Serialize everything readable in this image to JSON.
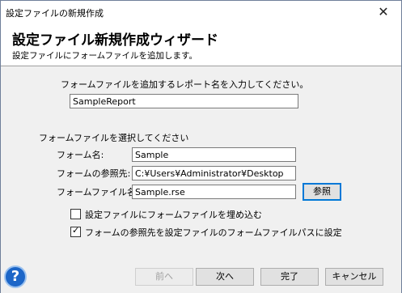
{
  "window": {
    "title": "設定ファイルの新規作成",
    "close_glyph": "✕"
  },
  "header": {
    "title": "設定ファイル新規作成ウィザード",
    "subtitle": "設定ファイルにフォームファイルを追加します。"
  },
  "report": {
    "prompt": "フォームファイルを追加するレポート名を入力してください。",
    "name_value": "SampleReport"
  },
  "form_select": {
    "heading": "フォームファイルを選択してください",
    "form_name_label": "フォーム名:",
    "form_name_value": "Sample",
    "ref_label": "フォームの参照先:",
    "ref_value": "C:¥Users¥Administrator¥Desktop",
    "file_label": "フォームファイル名:",
    "file_value": "Sample.rse",
    "browse_label": "参照"
  },
  "options": {
    "embed_label": "設定ファイルにフォームファイルを埋め込む",
    "embed_checked": false,
    "setpath_label": "フォームの参照先を設定ファイルのフォームファイルパスに設定",
    "setpath_checked": true,
    "check_glyph": "✓"
  },
  "footer": {
    "help_glyph": "?",
    "back_label": "前へ",
    "next_label": "次へ",
    "finish_label": "完了",
    "cancel_label": "キャンセル"
  }
}
